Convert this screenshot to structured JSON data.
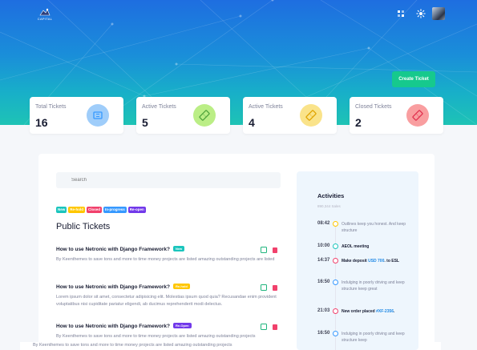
{
  "header": {
    "logo_text": "CAPITAL",
    "create_ticket_label": "Create Ticket",
    "icons": [
      "grid-icon",
      "sun-icon"
    ]
  },
  "stats": [
    {
      "label": "Total Tickets",
      "value": "16",
      "icon": "ticket-icon",
      "color": "#9fcdfa"
    },
    {
      "label": "Active Tickets",
      "value": "5",
      "icon": "ticket-icon",
      "color": "#bbee86"
    },
    {
      "label": "Active Tickets",
      "value": "4",
      "icon": "ticket-icon",
      "color": "#fae38a"
    },
    {
      "label": "Closed Tickets",
      "value": "2",
      "icon": "ticket-icon",
      "color": "#f99ea0"
    }
  ],
  "search": {
    "placeholder": "Search"
  },
  "status_chips": [
    {
      "label": "New",
      "color": "#1bc5bd"
    },
    {
      "label": "Re-hold",
      "color": "#ffc700"
    },
    {
      "label": "Closed",
      "color": "#f1416c"
    },
    {
      "label": "In-progress",
      "color": "#3699ff"
    },
    {
      "label": "Re-open",
      "color": "#7239ea"
    }
  ],
  "public_tickets": {
    "title": "Public Tickets",
    "items": [
      {
        "title": "How to use Netronic with Django Framework?",
        "badge": "New",
        "badge_color": "#1bc5bd",
        "description": "By Keenthemes to save tons and more to time money projects are listed amazing outstanding projects are listed"
      },
      {
        "title": "How to use Netronic with Django Framework?",
        "badge": "Re-hold",
        "badge_color": "#ffc700",
        "description": "Lorem ipsum dolor sit amet, consectetur adipisicing elit. Molestias ipsum quod quia? Recusandae enim provident voluptatibus nisi cupiditate pariatur eligendi, ab ducimus reprehenderit modi delectus."
      },
      {
        "title": "How to use Netronic with Django Framework?",
        "badge": "Re-Open",
        "badge_color": "#7239ea",
        "description": "By Keenthemes to save tons and more to time money projects are listed amazing outstanding projects"
      }
    ],
    "footer_text": "By Keenthemes to save tons and more to time money projects are listed amazing outstanding projects"
  },
  "activities": {
    "title": "Activities",
    "subtitle": "890,344 Sales",
    "items": [
      {
        "time": "08:42",
        "text": "Outlines keep you honest. And keep structure",
        "dot_color": "#ffc700",
        "bold": false
      },
      {
        "time": "10:00",
        "text": "AEOL meeting",
        "dot_color": "#1bc5bd",
        "bold": true
      },
      {
        "time": "14:37",
        "text_before": "Make deposit ",
        "link": "USD 700",
        "text_after": ". to ESL",
        "dot_color": "#f1416c",
        "bold": true
      },
      {
        "time": "16:50",
        "text": "Indulging in poorly driving and keep structure keep great",
        "dot_color": "#3699ff",
        "bold": false
      },
      {
        "time": "21:03",
        "text_before": "New order placed ",
        "link": "#XF-2356",
        "text_after": ".",
        "dot_color": "#f1416c",
        "bold": true
      },
      {
        "time": "16:50",
        "text": "Indulging in poorly driving and keep structure keep",
        "dot_color": "#3699ff",
        "bold": false
      }
    ]
  }
}
